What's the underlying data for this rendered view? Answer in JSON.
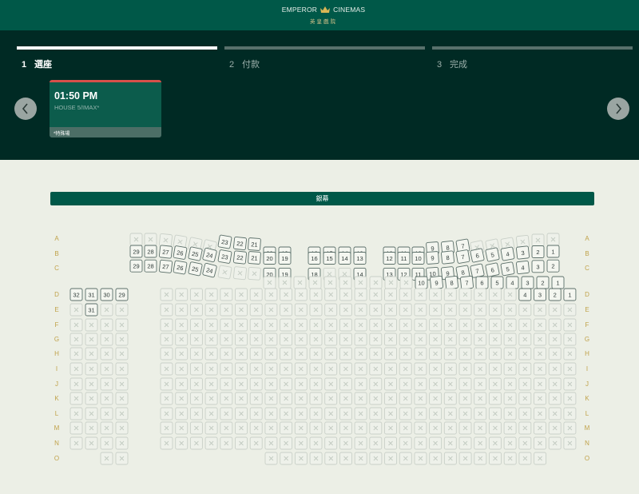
{
  "header": {
    "brand_left": "EMPEROR",
    "brand_right": "CINEMAS",
    "brand_chinese": "英皇戲院"
  },
  "steps": [
    {
      "num": "1",
      "label": "選座",
      "active": true
    },
    {
      "num": "2",
      "label": "付款",
      "active": false
    },
    {
      "num": "3",
      "label": "完成",
      "active": false
    }
  ],
  "showtime": {
    "time": "01:50 PM",
    "house": "HOUSE 5/IMAX*",
    "note": "*特殊場"
  },
  "screen_label": "銀幕",
  "row_labels": [
    "A",
    "B",
    "C",
    "D",
    "E",
    "F",
    "G",
    "H",
    "I",
    "J",
    "K",
    "L",
    "M",
    "N",
    "O"
  ],
  "seat_rows": [
    {
      "row": "A",
      "seats": [
        null,
        null,
        null,
        null,
        null,
        null,
        "23",
        "22",
        "21",
        "20",
        "19",
        "16",
        "15",
        "14",
        "13",
        "12",
        "11",
        "10",
        "9",
        "8",
        "7",
        null,
        null,
        null,
        null,
        null,
        null,
        null
      ]
    },
    {
      "row": "B",
      "seats": [
        "29",
        "28",
        "27",
        "26",
        "25",
        "24",
        "23",
        "22",
        "21",
        "20",
        "19",
        "16",
        "15",
        "14",
        "13",
        "12",
        "11",
        "10",
        "9",
        "8",
        "7",
        "6",
        "5",
        "4",
        "3",
        "2",
        "1"
      ]
    },
    {
      "row": "C",
      "seats": [
        "29",
        "28",
        "27",
        "26",
        "25",
        "24",
        null,
        null,
        null,
        "20",
        "19",
        "18",
        null,
        null,
        "14",
        "13",
        "12",
        "11",
        "10",
        "9",
        "8",
        "7",
        "6",
        "5",
        "4",
        "3",
        "2",
        "1"
      ]
    },
    {
      "row": "C2",
      "seats": [
        null,
        null,
        null,
        null,
        null,
        null,
        null,
        null,
        null,
        null,
        "10",
        "9",
        "8",
        "7",
        "6",
        "5",
        "4",
        "3",
        "2",
        "1"
      ]
    },
    {
      "row": "D",
      "seats": [
        "32",
        "31",
        "30",
        "29",
        "4",
        "3",
        "2",
        "1"
      ]
    },
    {
      "row": "E",
      "seats": [
        "31"
      ]
    }
  ],
  "colors": {
    "available": "#f4f6f0",
    "available_border": "#5b6f69",
    "unavailable_border": "#c9d0c8",
    "cross": "#c2cac1",
    "row_label": "#c0a24a"
  }
}
